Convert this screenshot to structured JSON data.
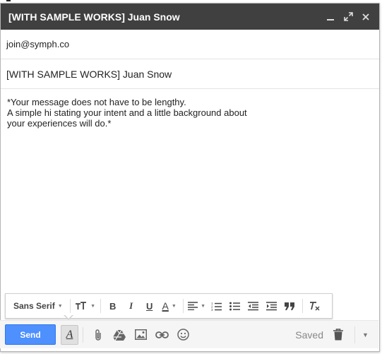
{
  "window": {
    "title": "[WITH SAMPLE WORKS] Juan Snow",
    "controls": [
      "minimize-icon",
      "expand-icon",
      "close-icon"
    ]
  },
  "recipients": {
    "to": "join@symph.co"
  },
  "subject": "[WITH SAMPLE WORKS] Juan Snow",
  "body": {
    "lines": [
      "*Your message does not have to be lengthy.",
      "A simple hi stating your intent and a little background about",
      "your experiences will do.*"
    ]
  },
  "format_bar": {
    "font": "Sans Serif",
    "size_icon": "text-size-icon",
    "bold": "B",
    "italic": "I",
    "underline": "U",
    "text_color": "A",
    "icons": [
      "align-icon",
      "numbered-list-icon",
      "bulleted-list-icon",
      "indent-less-icon",
      "indent-more-icon",
      "quote-icon",
      "remove-formatting-icon"
    ]
  },
  "bottom_bar": {
    "send_label": "Send",
    "format_label": "A",
    "saved_label": "Saved",
    "icons": [
      "attach-icon",
      "drive-icon",
      "photo-icon",
      "link-icon",
      "emoji-icon",
      "trash-icon",
      "more-options-icon"
    ]
  },
  "colors": {
    "titlebar": "#404040",
    "send": "#4d90fe"
  }
}
